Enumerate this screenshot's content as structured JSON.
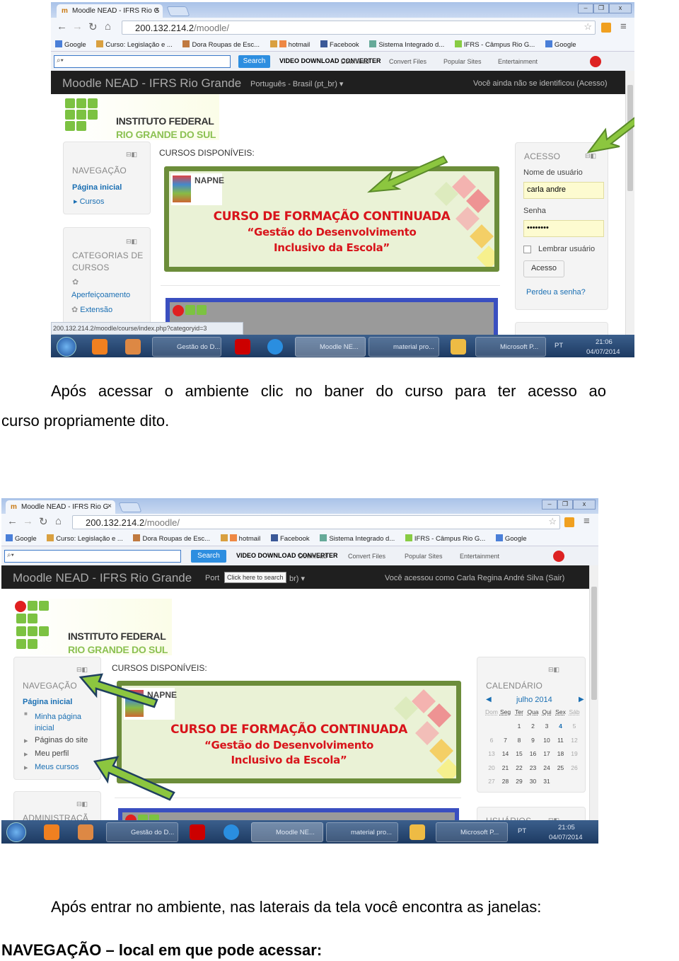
{
  "screenshot1": {
    "tab_title": "Moodle NEAD - IFRS Rio G",
    "url_host": "200.132.214.2",
    "url_path": "/moodle/",
    "bookmarks": [
      "Google",
      "Curso: Legislação e ...",
      "Dora Roupas de Esc...",
      "hotmail",
      "Facebook",
      "Sistema Integrado d...",
      "IFRS - Câmpus Rio G...",
      "Google"
    ],
    "search_button": "Search",
    "toolbar": [
      "VIDEO DOWNLOAD CONVERTER",
      "Download",
      "Convert Files",
      "Popular Sites",
      "Entertainment"
    ],
    "site_title": "Moodle NEAD - IFRS Rio Grande",
    "language": "Português - Brasil (pt_br) ▾",
    "login_status": "Você ainda não se identificou (Acesso)",
    "logo_line1": "INSTITUTO FEDERAL",
    "logo_line2": "RIO GRANDE DO SUL",
    "nav_block": {
      "title": "NAVEGAÇÃO",
      "items": [
        "Página inicial",
        "Cursos"
      ]
    },
    "categories_block": {
      "title": "CATEGORIAS DE CURSOS",
      "items": [
        "Aperfeiçoamento",
        "Extensão"
      ]
    },
    "courses_heading": "CURSOS DISPONÍVEIS:",
    "banner": {
      "logo": "NAPNE",
      "line1": "CURSO DE FORMAÇÃO CONTINUADA",
      "line2": "“Gestão do Desenvolvimento",
      "line3": "Inclusivo da Escola”"
    },
    "login_block": {
      "title": "ACESSO",
      "username_label": "Nome de usuário",
      "username_value": "carla andre",
      "password_label": "Senha",
      "password_value": "••••••••",
      "remember_label": "Lembrar usuário",
      "submit": "Acesso",
      "forgot": "Perdeu a senha?"
    },
    "status_url": "200.132.214.2/moodle/course/index.php?categoryid=3",
    "taskbar": {
      "items": [
        "Gestão do D...",
        "Moodle NE...",
        "material pro...",
        "Microsoft P..."
      ],
      "lang": "PT",
      "time": "21:06",
      "date": "04/07/2014"
    }
  },
  "paragraph1": "Após acessar o ambiente clic no baner do curso para ter acesso ao",
  "paragraph1_cont": "curso propriamente dito.",
  "screenshot2": {
    "tab_title": "Moodle NEAD - IFRS Rio G",
    "url_host": "200.132.214.2",
    "url_path": "/moodle/",
    "bookmarks": [
      "Google",
      "Curso: Legislação e ...",
      "Dora Roupas de Esc...",
      "hotmail",
      "Facebook",
      "Sistema Integrado d...",
      "IFRS - Câmpus Rio G...",
      "Google"
    ],
    "search_button": "Search",
    "toolbar": [
      "VIDEO DOWNLOAD CONVERTER",
      "Download",
      "Convert Files",
      "Popular Sites",
      "Entertainment"
    ],
    "site_title": "Moodle NEAD - IFRS Rio Grande",
    "language_partial": "Port",
    "language_tail": "br) ▾",
    "tooltip": "Click here to search",
    "login_status": "Você acessou como Carla Regina André Silva (Sair)",
    "logo_line1": "INSTITUTO FEDERAL",
    "logo_line2": "RIO GRANDE DO SUL",
    "nav_block": {
      "title": "NAVEGAÇÃO",
      "items": [
        "Página inicial",
        "Minha página inicial",
        "Páginas do site",
        "Meu perfil",
        "Meus cursos"
      ]
    },
    "admin_block": {
      "title": "ADMINISTRAÇÃ"
    },
    "courses_heading": "CURSOS DISPONÍVEIS:",
    "banner": {
      "logo": "NAPNE",
      "line1": "CURSO DE FORMAÇÃO CONTINUADA",
      "line2": "“Gestão do Desenvolvimento",
      "line3": "Inclusivo da Escola”"
    },
    "calendar": {
      "title": "CALENDÁRIO",
      "month": "julho 2014",
      "weekdays": [
        "Dom",
        "Seg",
        "Ter",
        "Qua",
        "Qui",
        "Sex",
        "Sáb"
      ],
      "weeks": [
        [
          "",
          "",
          "1",
          "2",
          "3",
          "4",
          "5"
        ],
        [
          "6",
          "7",
          "8",
          "9",
          "10",
          "11",
          "12"
        ],
        [
          "13",
          "14",
          "15",
          "16",
          "17",
          "18",
          "19"
        ],
        [
          "20",
          "21",
          "22",
          "23",
          "24",
          "25",
          "26"
        ],
        [
          "27",
          "28",
          "29",
          "30",
          "31",
          "",
          ""
        ]
      ],
      "today": "4"
    },
    "users_block": {
      "title": "USUÁRIOS"
    },
    "taskbar": {
      "items": [
        "Gestão do D...",
        "Moodle NE...",
        "material pro...",
        "Microsoft P..."
      ],
      "lang": "PT",
      "time": "21:05",
      "date": "04/07/2014"
    }
  },
  "paragraph2": "Após entrar no ambiente, nas laterais da tela  você encontra as janelas:",
  "heading": "NAVEGAÇÃO – local em que pode acessar:",
  "colors": {
    "arrow": "#8cc63f",
    "arrow_outline": "#1f3f5f",
    "banner_border": "#6c8d3a",
    "banner_text": "#d8141b",
    "moodle_header": "#1f1f1f",
    "link": "#1a6fb3"
  }
}
